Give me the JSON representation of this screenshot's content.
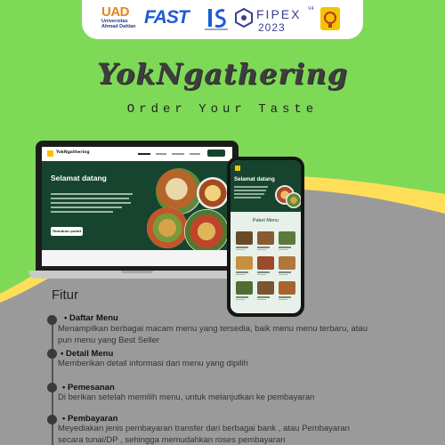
{
  "logos": {
    "uad_big": "UAD",
    "uad_small_1": "Universitas",
    "uad_small_2": "Ahmad Dahlan",
    "fast": "FAST",
    "fipex_name": "FIPEX",
    "fipex_sup": "V4",
    "fipex_year": "2023"
  },
  "brand": {
    "title": "YokNgathering",
    "subtitle": "Order Your Taste"
  },
  "laptop": {
    "nav_brand": "YokNgathering",
    "hero_heading": "Selamat datang",
    "cta_label": "Temukan paket"
  },
  "phone": {
    "hero_heading": "Selamat datang",
    "menu_title": "Paket Menu"
  },
  "colors": {
    "background_green": "#7ed957",
    "grey_wave": "#9a9a9a",
    "yellow_wave": "#ffde59",
    "app_dark_green": "#17442e"
  },
  "fitur": {
    "title": "Fitur",
    "items": [
      {
        "title": "• Daftar Menu",
        "desc": "Menampilkan berbagai macam menu yang tersedia, baik menu menu terbaru, atau pun menu yang Best Seller"
      },
      {
        "title": "• Detail Menu",
        "desc": "Memberikan detail informasi dari menu yang dipilih"
      },
      {
        "title": "• Pemesanan",
        "desc": "Di berikan setelah memilih menu, untuk melanjutkan ke pembayaran"
      },
      {
        "title": "• Pembayaran",
        "desc": "Meyediakan jenis pembayaran transfer dari berbagai bank , atau Pembayaran secara tunai/DP , sehingga memudahkan roses pembayaran"
      }
    ]
  }
}
